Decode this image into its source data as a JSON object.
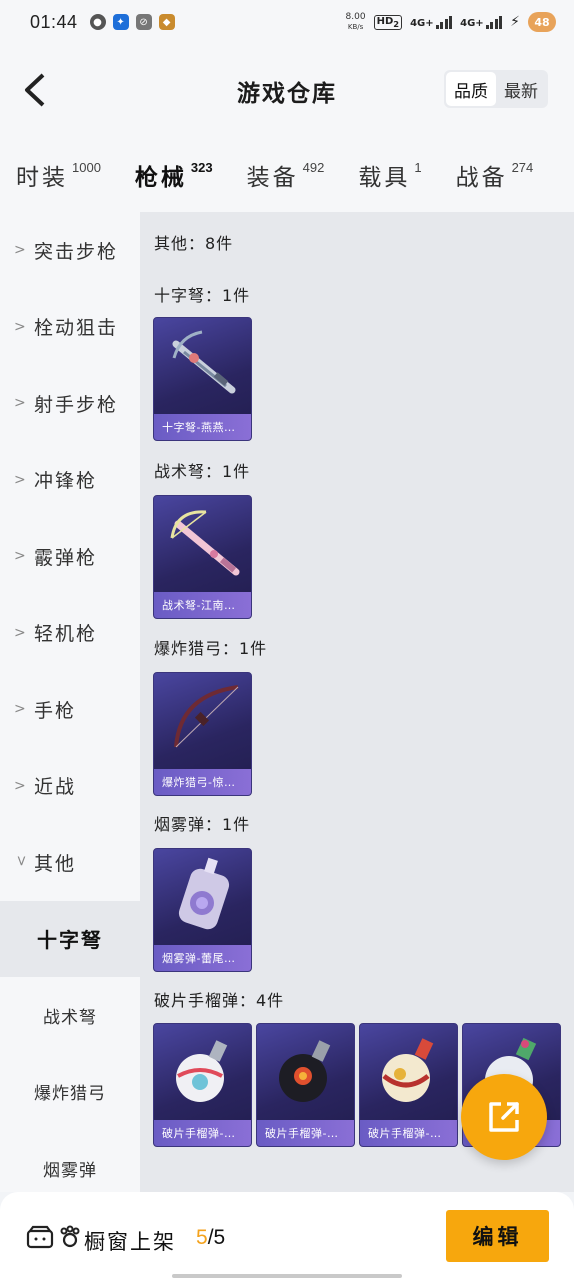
{
  "status": {
    "time": "01:44",
    "speed_value": "8.00",
    "speed_unit": "KB/s",
    "hd": "HD",
    "hd_sub": "2",
    "net1": "4G+",
    "net2": "4G+",
    "battery": "48"
  },
  "header": {
    "title": "游戏仓库",
    "sort_quality": "品质",
    "sort_newest": "最新"
  },
  "tabs": [
    {
      "label": "时装",
      "count": "1000"
    },
    {
      "label": "枪械",
      "count": "323"
    },
    {
      "label": "装备",
      "count": "492"
    },
    {
      "label": "载具",
      "count": "1"
    },
    {
      "label": "战备",
      "count": "274"
    }
  ],
  "sidebar": {
    "categories": [
      "突击步枪",
      "栓动狙击",
      "射手步枪",
      "冲锋枪",
      "霰弹枪",
      "轻机枪",
      "手枪",
      "近战",
      "其他"
    ],
    "subs": [
      "十字弩",
      "战术弩",
      "爆炸猎弓",
      "烟雾弹"
    ]
  },
  "main": {
    "summary": "其他：8件",
    "groups": [
      {
        "title": "十字弩：1件",
        "items": [
          "十字弩-燕燕…"
        ]
      },
      {
        "title": "战术弩：1件",
        "items": [
          "战术弩-江南…"
        ]
      },
      {
        "title": "爆炸猎弓：1件",
        "items": [
          "爆炸猎弓-惊…"
        ]
      },
      {
        "title": "烟雾弹：1件",
        "items": [
          "烟雾弹-蕾尾…"
        ]
      },
      {
        "title": "破片手榴弹：4件",
        "items": [
          "破片手榴弹-…",
          "破片手榴弹-…",
          "破片手榴弹-…",
          ""
        ]
      }
    ]
  },
  "bottom": {
    "label": "橱窗上架",
    "current": "5",
    "total": "/5",
    "edit": "编辑"
  },
  "colors": {
    "accent": "#f7a70d",
    "card_bg": "#2a2560",
    "caption": "#7a66cf"
  }
}
